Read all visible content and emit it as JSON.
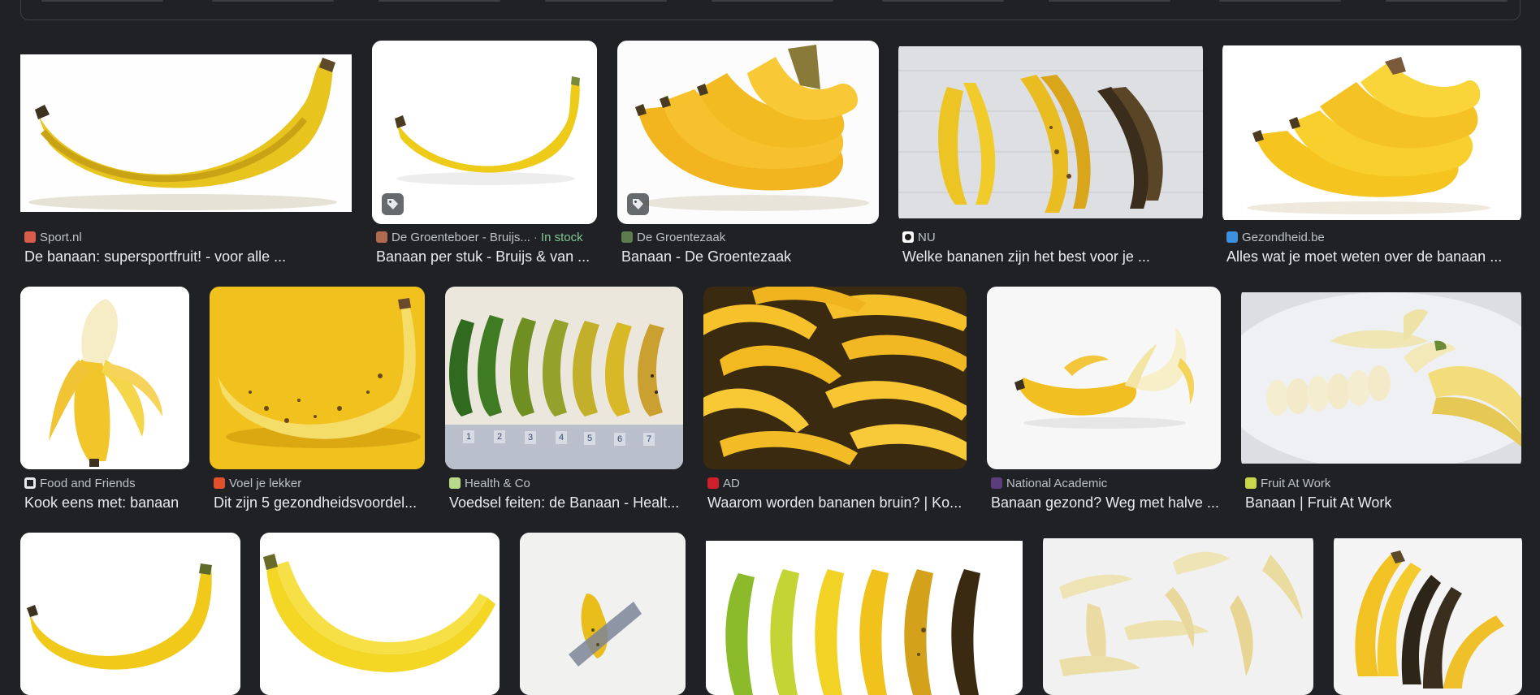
{
  "results": [
    {
      "source": "Sport.nl",
      "title": "De banaan: supersportfruit! - voor alle ...",
      "favicon_color": "#d85c4a",
      "favicon_icon": "sport-favicon"
    },
    {
      "source": "De Groenteboer - Bruijs...",
      "badge": "In stock",
      "title": "Banaan per stuk - Bruijs & van ...",
      "favicon_color": "#b06a4e",
      "favicon_icon": "groenteboer-favicon",
      "tag_icon": "shopping-tag-icon"
    },
    {
      "source": "De Groentezaak",
      "title": "Banaan - De Groentezaak",
      "favicon_color": "#5d7b4d",
      "favicon_icon": "groentezaak-favicon",
      "tag_icon": "shopping-tag-icon"
    },
    {
      "source": "NU",
      "title": "Welke bananen zijn het best voor je ...",
      "favicon_color": "#ffffff",
      "favicon_icon": "nu-favicon"
    },
    {
      "source": "Gezondheid.be",
      "title": "Alles wat je moet weten over de banaan ...",
      "favicon_color": "#3d8fe0",
      "favicon_icon": "gezondheid-favicon"
    },
    {
      "source": "Food and Friends",
      "title": "Kook eens met: banaan",
      "favicon_color": "#e8eaed",
      "favicon_icon": "food-and-friends-favicon"
    },
    {
      "source": "Voel je lekker",
      "title": "Dit zijn 5 gezondheidsvoordel...",
      "favicon_color": "#e0502c",
      "favicon_icon": "voel-je-lekker-favicon"
    },
    {
      "source": "Health & Co",
      "title": "Voedsel feiten: de Banaan - Healt...",
      "favicon_color": "#b8d88a",
      "favicon_icon": "health-and-co-favicon"
    },
    {
      "source": "AD",
      "title": "Waarom worden bananen bruin? | Ko...",
      "favicon_color": "#d01f2a",
      "favicon_icon": "ad-favicon"
    },
    {
      "source": "National Academic",
      "title": "Banaan gezond? Weg met halve ...",
      "favicon_color": "#5a3d7a",
      "favicon_icon": "national-academic-favicon"
    },
    {
      "source": "Fruit At Work",
      "title": "Banaan | Fruit At Work",
      "favicon_color": "#c8d84a",
      "favicon_icon": "fruit-at-work-favicon"
    },
    {},
    {},
    {},
    {},
    {},
    {}
  ],
  "thumbnail_labels": {
    "ripeness_scale": [
      "1",
      "2",
      "3",
      "4",
      "5",
      "6",
      "7"
    ]
  },
  "colors": {
    "background": "#202124",
    "title_text": "#e8eaed",
    "source_text": "#bdc1c6",
    "in_stock": "#81c995"
  }
}
